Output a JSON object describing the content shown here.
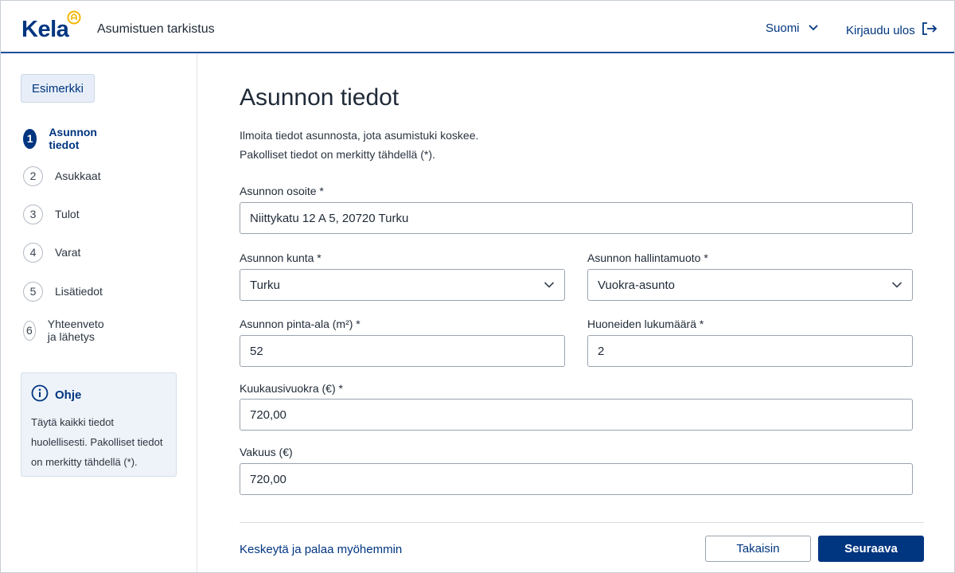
{
  "header": {
    "logo_text": "Kela",
    "app_title": "Asumistuen tarkistus",
    "language": "Suomi",
    "logout": "Kirjaudu ulos"
  },
  "sidebar": {
    "example_tag": "Esimerkki",
    "steps": [
      {
        "num": "1",
        "label": "Asunnon tiedot",
        "active": true
      },
      {
        "num": "2",
        "label": "Asukkaat",
        "active": false
      },
      {
        "num": "3",
        "label": "Tulot",
        "active": false
      },
      {
        "num": "4",
        "label": "Varat",
        "active": false
      },
      {
        "num": "5",
        "label": "Lisätiedot",
        "active": false
      },
      {
        "num": "6",
        "label": "Yhteenveto ja lähetys",
        "active": false
      }
    ],
    "help": {
      "title": "Ohje",
      "text": "Täytä kaikki tiedot huolellisesti. Pakolliset tiedot on merkitty tähdellä (*)."
    }
  },
  "main": {
    "title": "Asunnon tiedot",
    "intro_line1": "Ilmoita tiedot asunnosta, jota asumistuki koskee.",
    "intro_line2": "Pakolliset tiedot on merkitty tähdellä (*).",
    "fields": {
      "address": {
        "label": "Asunnon osoite *",
        "value": "Niittykatu 12 A 5, 20720 Turku"
      },
      "municipality": {
        "label": "Asunnon kunta *",
        "value": "Turku"
      },
      "tenure": {
        "label": "Asunnon hallintamuoto *",
        "value": "Vuokra-asunto"
      },
      "area": {
        "label": "Asunnon pinta-ala (m²) *",
        "value": "52"
      },
      "rooms": {
        "label": "Huoneiden lukumäärä *",
        "value": "2"
      },
      "rent": {
        "label": "Kuukausivuokra (€) *",
        "value": "720,00"
      },
      "deposit": {
        "label": "Vakuus (€)",
        "value": "720,00"
      }
    },
    "cancel_link": "Keskeytä ja palaa myöhemmin",
    "back_button": "Takaisin",
    "next_button": "Seuraava"
  },
  "colors": {
    "brand": "#003580",
    "accent_badge": "#f2b705",
    "help_bg": "#eef3f9"
  }
}
